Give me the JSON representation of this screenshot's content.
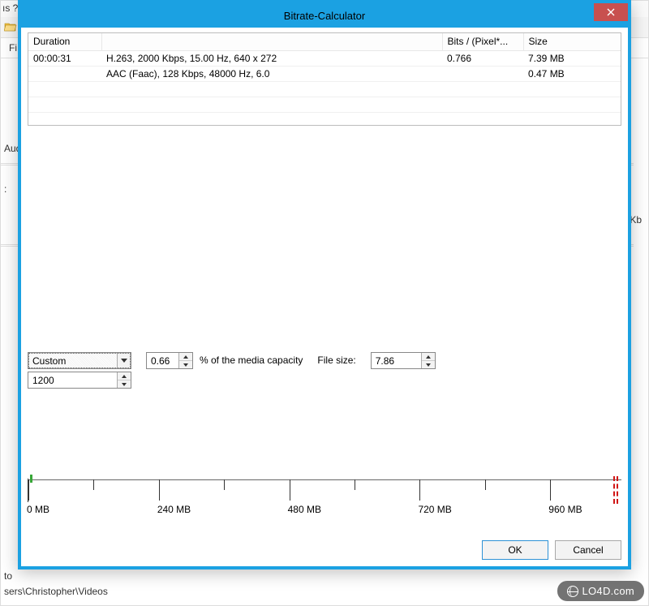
{
  "background": {
    "menu_fragment": "ıs    ?",
    "fi_label": "Fi",
    "aud_label": "Aud",
    "colon": ":",
    "kb_label": "Kb",
    "to_label": "to",
    "path_fragment": "sers\\Christopher\\Videos"
  },
  "dialog": {
    "title": "Bitrate-Calculator",
    "table": {
      "headers": {
        "duration": "Duration",
        "encoding": "",
        "bits": "Bits / (Pixel*...",
        "size": "Size"
      },
      "rows": [
        {
          "duration": "00:00:31",
          "encoding": "H.263, 2000 Kbps, 15.00 Hz, 640 x 272",
          "bits": "0.766",
          "size": "7.39 MB"
        },
        {
          "duration": "",
          "encoding": "AAC (Faac), 128 Kbps, 48000 Hz, 6.0",
          "bits": "",
          "size": "0.47 MB"
        }
      ]
    },
    "preset": {
      "selected": "Custom",
      "value": "1200"
    },
    "capacity_pct": "0.66",
    "capacity_label": "% of the media capacity",
    "filesize_label": "File size:",
    "filesize_value": "7.86",
    "ruler": {
      "labels": [
        "0 MB",
        "240 MB",
        "480 MB",
        "720 MB",
        "960 MB"
      ]
    },
    "buttons": {
      "ok": "OK",
      "cancel": "Cancel"
    }
  },
  "watermark": "LO4D.com"
}
